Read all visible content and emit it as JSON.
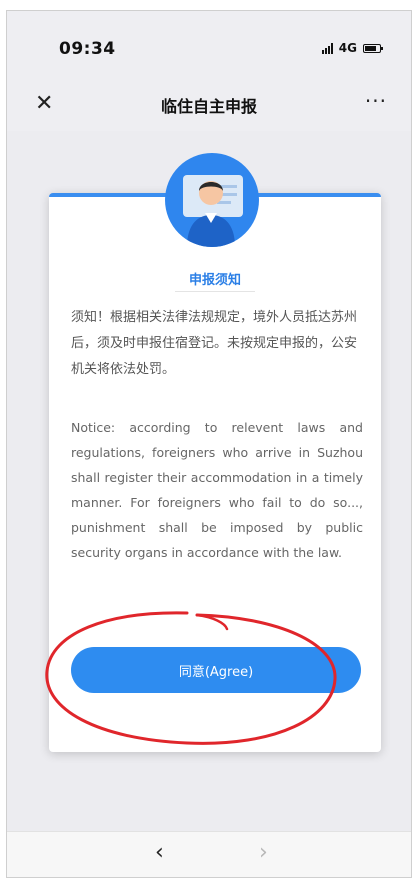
{
  "status_bar": {
    "time": "09:34",
    "network": "4G"
  },
  "nav": {
    "close_icon": "close-icon",
    "title": "临住自主申报",
    "more_label": "···"
  },
  "card": {
    "avatar_icon": "user-id-card-icon",
    "title": "申报须知",
    "notice_cn": "须知！根据相关法律法规规定，境外人员抵达苏州后，须及时申报住宿登记。未按规定申报的，公安机关将依法处罚。",
    "notice_en": "Notice: according to relevent laws and regulations, foreigners who arrive in Suzhou shall register their accommodation in a timely manner. For foreigners who fail to do so..., punishment shall be imposed by public security organs in accordance with the law.",
    "agree_label": "同意(Agree)"
  },
  "annotation": {
    "color": "#e0262b"
  },
  "toolbar": {
    "back_label": "‹",
    "forward_label": "›"
  },
  "colors": {
    "accent": "#2e8cf0",
    "title_blue": "#2b7fe6"
  }
}
